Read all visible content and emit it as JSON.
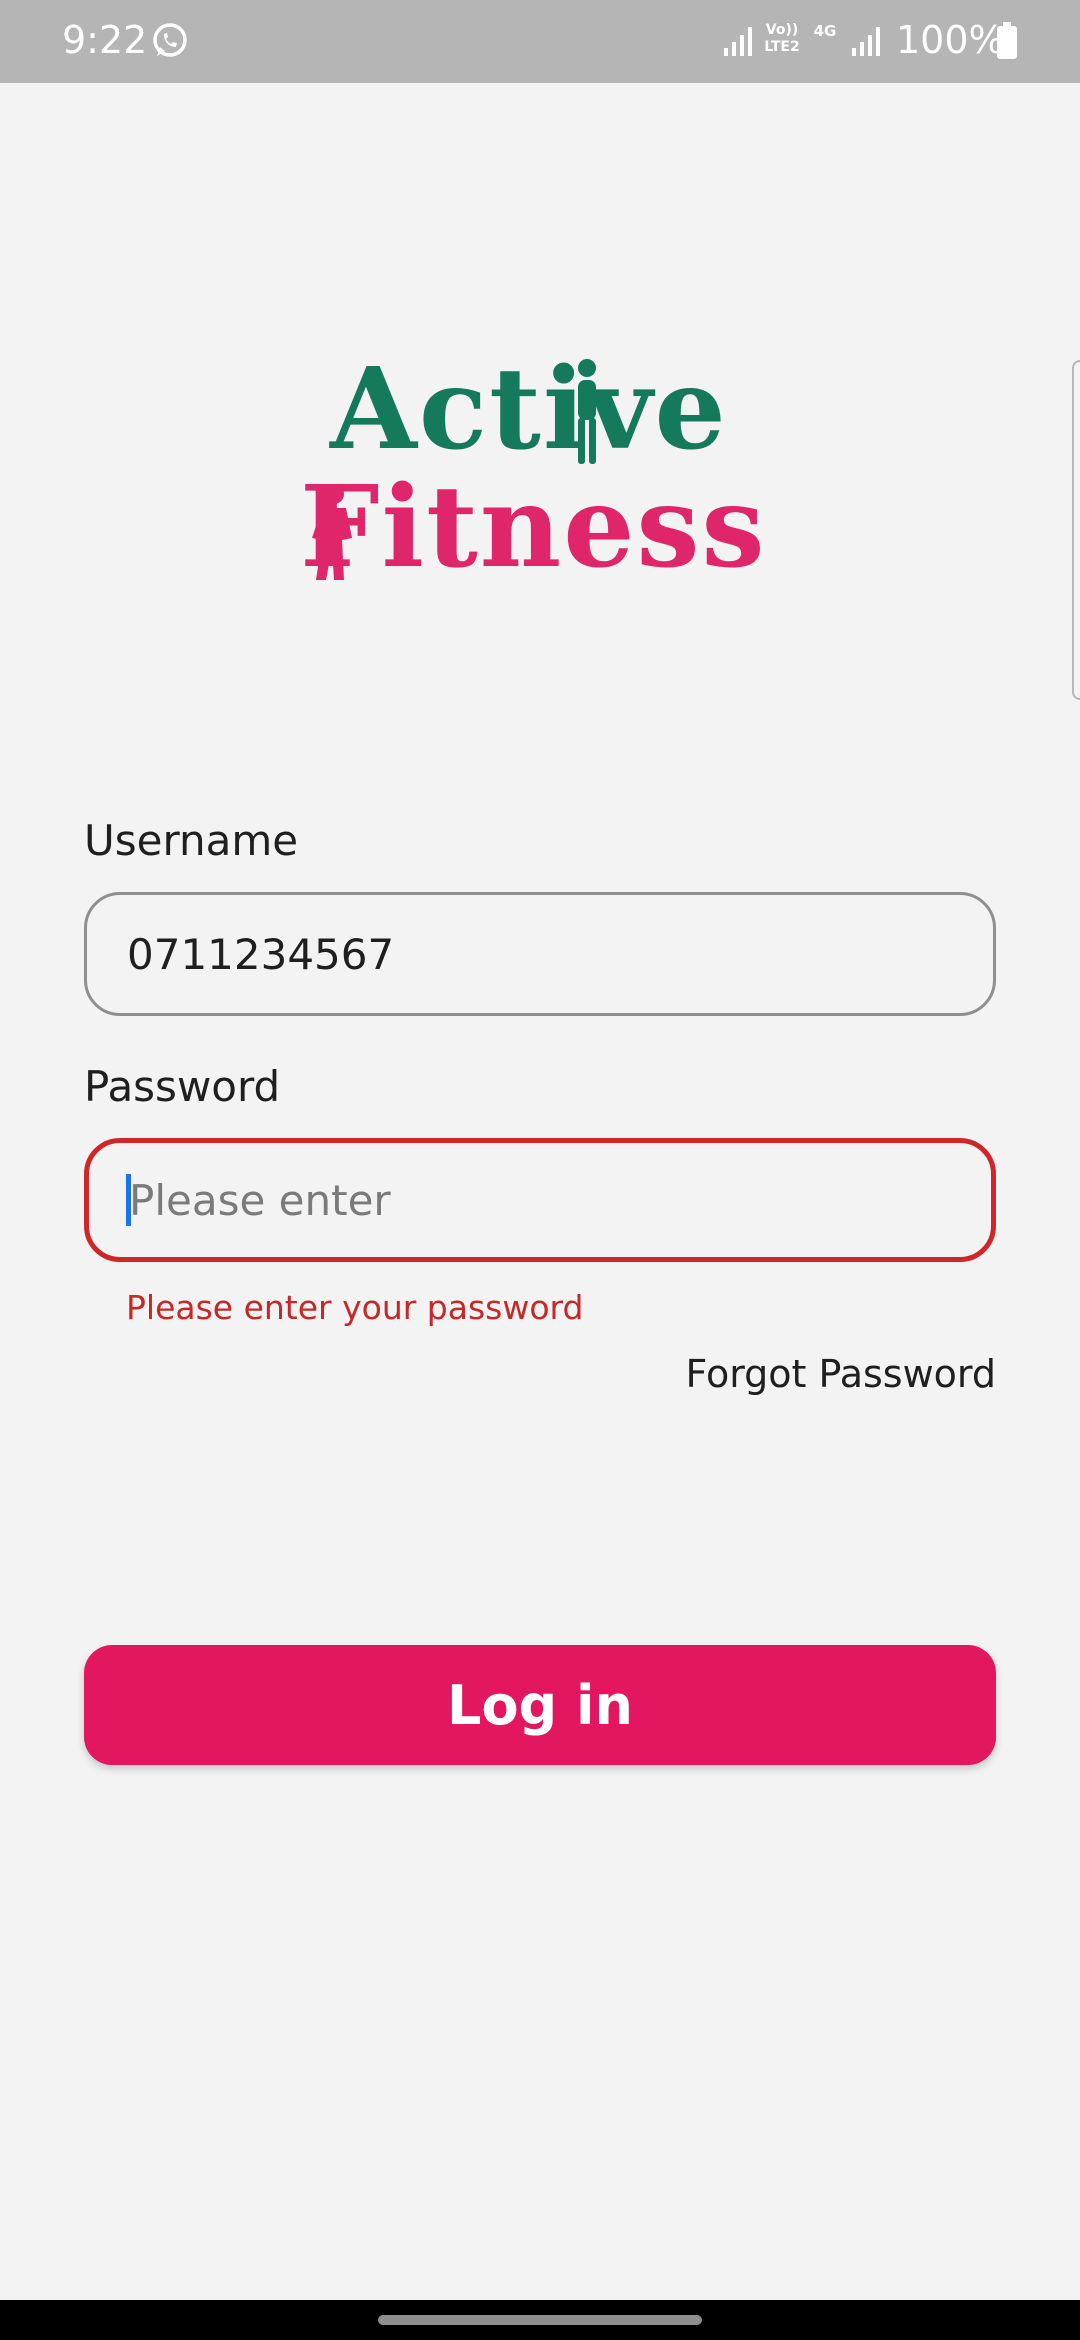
{
  "status_bar": {
    "time": "9:22",
    "lte_label": "Vo)) LTE2",
    "network_label": "4G",
    "battery": "100%",
    "icons": [
      "whatsapp-icon",
      "signal-icon",
      "lte-icon",
      "4g-icon",
      "signal-icon",
      "battery-icon"
    ]
  },
  "logo": {
    "line1": "Active",
    "line2": "Fitness",
    "colors": {
      "active": "#157a5c",
      "fitness": "#e0266a"
    }
  },
  "form": {
    "username_label": "Username",
    "username_value": "0711234567",
    "password_label": "Password",
    "password_placeholder": "Please enter",
    "password_error": "Please enter your password",
    "forgot_password": "Forgot Password",
    "login_button": "Log in"
  },
  "colors": {
    "accent": "#e3175f",
    "error": "#c62828",
    "background": "#f3f3f3"
  }
}
